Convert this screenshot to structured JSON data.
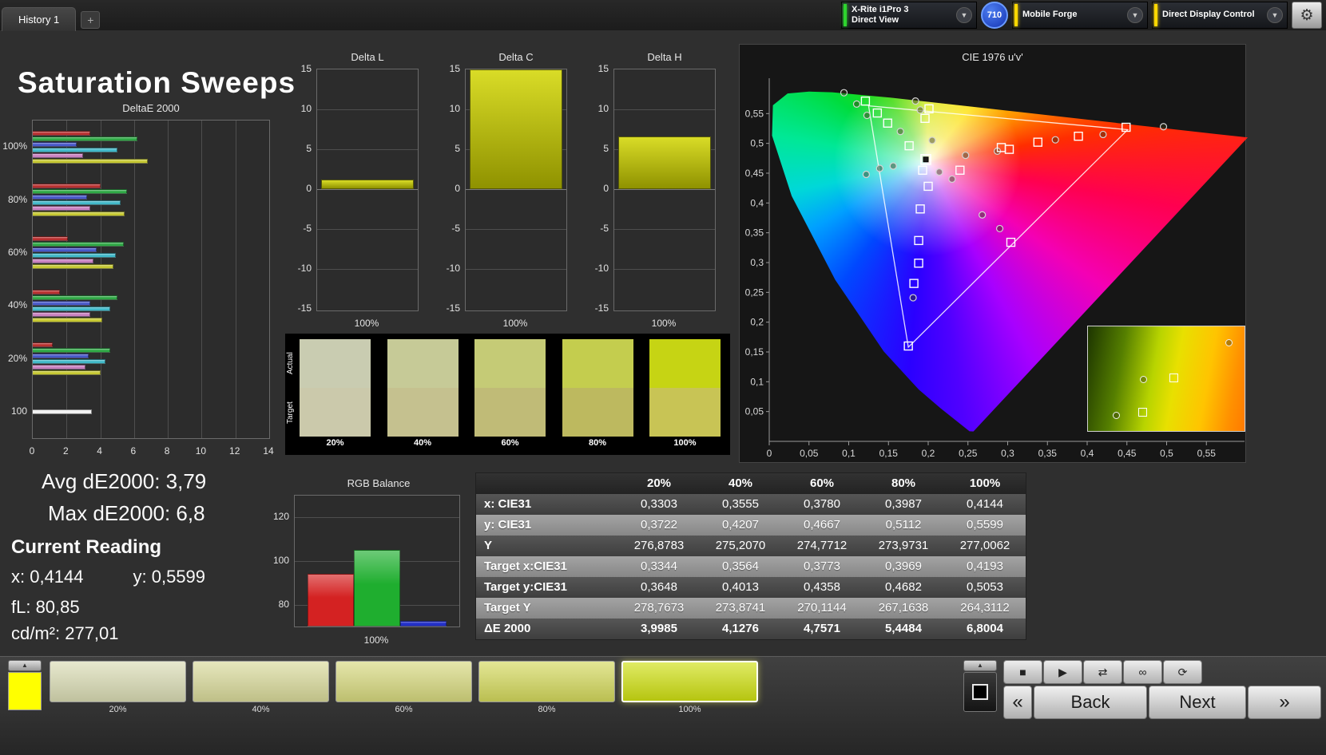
{
  "topbar": {
    "history_tab": "History 1",
    "add_tab": "+",
    "meter_line1": "X-Rite i1Pro 3",
    "meter_line2": "Direct View",
    "badge": "710",
    "source": "Mobile Forge",
    "workflow": "Direct Display Control"
  },
  "title": "Saturation Sweeps",
  "deltae": {
    "title": "DeltaE 2000",
    "x_ticks": [
      "0",
      "2",
      "4",
      "6",
      "8",
      "10",
      "12",
      "14"
    ],
    "x_max": 14,
    "series_colors": [
      "#b83030",
      "#2fa845",
      "#4858c8",
      "#40b8c8",
      "#c880c0",
      "#c6c832"
    ],
    "white_color": "#f0f0f0",
    "groups": [
      {
        "label": "100%",
        "values": [
          3.4,
          6.2,
          2.6,
          5.0,
          3.0,
          6.8
        ]
      },
      {
        "label": "80%",
        "values": [
          4.0,
          5.6,
          3.2,
          5.2,
          3.4,
          5.45
        ]
      },
      {
        "label": "60%",
        "values": [
          2.1,
          5.4,
          3.8,
          4.9,
          3.6,
          4.76
        ]
      },
      {
        "label": "40%",
        "values": [
          1.6,
          5.0,
          3.4,
          4.6,
          3.4,
          4.13
        ]
      },
      {
        "label": "20%",
        "values": [
          1.2,
          4.6,
          3.3,
          4.3,
          3.1,
          4.0
        ]
      },
      {
        "label": "100",
        "values": [
          3.5
        ]
      }
    ]
  },
  "delta_charts": {
    "axis_ticks": [
      "15",
      "10",
      "5",
      "0",
      "-5",
      "-10",
      "-15"
    ],
    "x_label": "100%",
    "charts": [
      {
        "title": "Delta L",
        "value": 1.2
      },
      {
        "title": "Delta C",
        "value": 15
      },
      {
        "title": "Delta H",
        "value": 6.6
      }
    ]
  },
  "swatch_strip": {
    "row_labels": [
      "Actual",
      "Target"
    ],
    "columns": [
      {
        "label": "20%",
        "actual": "#c9ccb1",
        "target": "#cbc9ab"
      },
      {
        "label": "40%",
        "actual": "#c6ca97",
        "target": "#c5c18f"
      },
      {
        "label": "60%",
        "actual": "#c5cb76",
        "target": "#c0bb77"
      },
      {
        "label": "80%",
        "actual": "#c4cd4e",
        "target": "#bdb95f"
      },
      {
        "label": "100%",
        "actual": "#c6d414",
        "target": "#c8c455"
      }
    ]
  },
  "cie": {
    "title": "CIE 1976 u'v'",
    "axis_ticks": [
      "0",
      "0,05",
      "0,1",
      "0,15",
      "0,2",
      "0,25",
      "0,3",
      "0,35",
      "0,4",
      "0,45",
      "0,5",
      "0,55"
    ],
    "triangle": [
      [
        0.451,
        0.523
      ],
      [
        0.125,
        0.563
      ],
      [
        0.175,
        0.158
      ]
    ],
    "squares": [
      [
        0.121,
        0.571
      ],
      [
        0.136,
        0.551
      ],
      [
        0.149,
        0.534
      ],
      [
        0.201,
        0.558
      ],
      [
        0.196,
        0.542
      ],
      [
        0.176,
        0.496
      ],
      [
        0.193,
        0.455
      ],
      [
        0.2,
        0.428
      ],
      [
        0.19,
        0.39
      ],
      [
        0.188,
        0.337
      ],
      [
        0.188,
        0.299
      ],
      [
        0.182,
        0.265
      ],
      [
        0.175,
        0.16
      ],
      [
        0.292,
        0.493
      ],
      [
        0.302,
        0.49
      ],
      [
        0.338,
        0.502
      ],
      [
        0.389,
        0.512
      ],
      [
        0.449,
        0.527
      ],
      [
        0.304,
        0.334
      ],
      [
        0.24,
        0.455
      ]
    ],
    "circles": [
      [
        0.094,
        0.585
      ],
      [
        0.11,
        0.566
      ],
      [
        0.123,
        0.547
      ],
      [
        0.184,
        0.571
      ],
      [
        0.19,
        0.556
      ],
      [
        0.122,
        0.448
      ],
      [
        0.139,
        0.458
      ],
      [
        0.156,
        0.462
      ],
      [
        0.214,
        0.452
      ],
      [
        0.23,
        0.44
      ],
      [
        0.247,
        0.48
      ],
      [
        0.287,
        0.487
      ],
      [
        0.36,
        0.506
      ],
      [
        0.42,
        0.515
      ],
      [
        0.496,
        0.528
      ],
      [
        0.268,
        0.38
      ],
      [
        0.29,
        0.357
      ],
      [
        0.181,
        0.241
      ],
      [
        0.205,
        0.505
      ],
      [
        0.165,
        0.52
      ]
    ],
    "highlight": [
      0.197,
      0.473
    ],
    "inset": {
      "circles": [
        [
          0.88,
          0.12
        ],
        [
          0.33,
          0.47
        ],
        [
          0.16,
          0.82
        ]
      ],
      "squares": [
        [
          0.52,
          0.45
        ],
        [
          0.32,
          0.78
        ]
      ]
    }
  },
  "stats": {
    "avg": "Avg dE2000: 3,79",
    "max": "Max dE2000: 6,8"
  },
  "current_reading": {
    "heading": "Current Reading",
    "x": "x: 0,4144",
    "y": "y: 0,5599",
    "fl": "fL: 80,85",
    "luminance": "cd/m²: 277,01"
  },
  "rgb_balance": {
    "title": "RGB Balance",
    "x_label": "100%",
    "axis_min": 70,
    "axis_max": 130,
    "y_ticks": [
      120,
      100,
      80
    ],
    "bars": [
      {
        "name": "red",
        "value": 94,
        "color": "#d42222"
      },
      {
        "name": "green",
        "value": 105,
        "color": "#1fae2f"
      },
      {
        "name": "blue",
        "value": 72.5,
        "color": "#2330c8"
      }
    ]
  },
  "table": {
    "columns": [
      "20%",
      "40%",
      "60%",
      "80%",
      "100%"
    ],
    "rows": [
      {
        "label": "x: CIE31",
        "values": [
          "0,3303",
          "0,3555",
          "0,3780",
          "0,3987",
          "0,4144"
        ]
      },
      {
        "label": "y: CIE31",
        "values": [
          "0,3722",
          "0,4207",
          "0,4667",
          "0,5112",
          "0,5599"
        ]
      },
      {
        "label": "Y",
        "values": [
          "276,8783",
          "275,2070",
          "274,7712",
          "273,9731",
          "277,0062"
        ]
      },
      {
        "label": "Target x:CIE31",
        "values": [
          "0,3344",
          "0,3564",
          "0,3773",
          "0,3969",
          "0,4193"
        ]
      },
      {
        "label": "Target y:CIE31",
        "values": [
          "0,3648",
          "0,4013",
          "0,4358",
          "0,4682",
          "0,5053"
        ]
      },
      {
        "label": "Target Y",
        "values": [
          "278,7673",
          "273,8741",
          "270,1144",
          "267,1638",
          "264,3112"
        ]
      },
      {
        "label": "ΔE 2000",
        "values": [
          "3,9985",
          "4,1276",
          "4,7571",
          "5,4484",
          "6,8004"
        ]
      }
    ]
  },
  "bottom_bar": {
    "current_color": "#ffff00",
    "up_glyph": "▲",
    "swatches": [
      {
        "label": "20%",
        "color": "#dadcb4",
        "selected": false
      },
      {
        "label": "40%",
        "color": "#d9da9a",
        "selected": false
      },
      {
        "label": "60%",
        "color": "#d7d97e",
        "selected": false
      },
      {
        "label": "80%",
        "color": "#d4d95c",
        "selected": false
      },
      {
        "label": "100%",
        "color": "#cfe012",
        "selected": true
      }
    ],
    "transport": [
      {
        "name": "stop-icon",
        "glyph": "■"
      },
      {
        "name": "play-icon",
        "glyph": "▶"
      },
      {
        "name": "measure-series-icon",
        "glyph": "⇄"
      },
      {
        "name": "continuous-icon",
        "glyph": "∞"
      },
      {
        "name": "refresh-icon",
        "glyph": "⟳"
      }
    ],
    "prev_glyph": "«",
    "back": "Back",
    "next": "Next",
    "next_glyph": "»"
  }
}
